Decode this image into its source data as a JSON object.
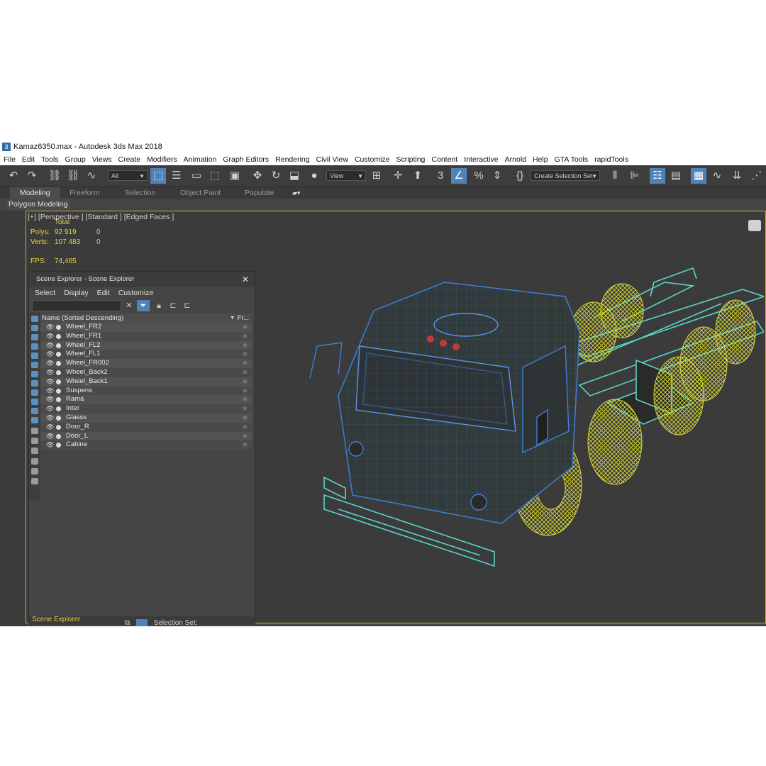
{
  "window": {
    "title": "Kamaz6350.max - Autodesk 3ds Max 2018",
    "app_icon": "3"
  },
  "menu": [
    "File",
    "Edit",
    "Tools",
    "Group",
    "Views",
    "Create",
    "Modifiers",
    "Animation",
    "Graph Editors",
    "Rendering",
    "Civil View",
    "Customize",
    "Scripting",
    "Content",
    "Interactive",
    "Arnold",
    "Help",
    "GTA Tools",
    "rapidTools"
  ],
  "toolbar": {
    "filter_value": "All",
    "refcoord_value": "View",
    "selection_set_placeholder": "Create Selection Set"
  },
  "ribbon": {
    "tabs": [
      "Modeling",
      "Freeform",
      "Selection",
      "Object Paint",
      "Populate"
    ],
    "active_tab": "Modeling",
    "panel": "Polygon Modeling"
  },
  "viewport": {
    "label": "[+] [Perspective ] [Standard ] [Edged Faces ]",
    "stats": {
      "header": "Total",
      "polys_label": "Polys:",
      "polys_total": "92 919",
      "polys_sel": "0",
      "verts_label": "Verts:",
      "verts_total": "107 483",
      "verts_sel": "0",
      "fps_label": "FPS:",
      "fps_value": "74,465"
    }
  },
  "scene_explorer": {
    "title": "Scene Explorer - Scene Explorer",
    "menu": [
      "Select",
      "Display",
      "Edit",
      "Customize"
    ],
    "column_name": "Name (Sorted Descending)",
    "column_frozen": "Fr...",
    "items": [
      "Wheel_FR2",
      "Wheel_FR1",
      "Wheel_FL2",
      "Wheel_FL1",
      "Wheel_FR002",
      "Wheel_Back2",
      "Wheel_Back1",
      "Suspens",
      "Rama",
      "Inter",
      "Glasss",
      "Door_R",
      "Door_L",
      "Cabine"
    ],
    "bottom_tab": "Scene Explorer",
    "selection_set_label": "Selection Set:"
  },
  "colors": {
    "accent": "#4f83b7",
    "stats": "#e8d43a",
    "wire_cab": "#3f7fd6",
    "wire_frame": "#59d6c8",
    "wire_wheels": "#d8d83a"
  }
}
